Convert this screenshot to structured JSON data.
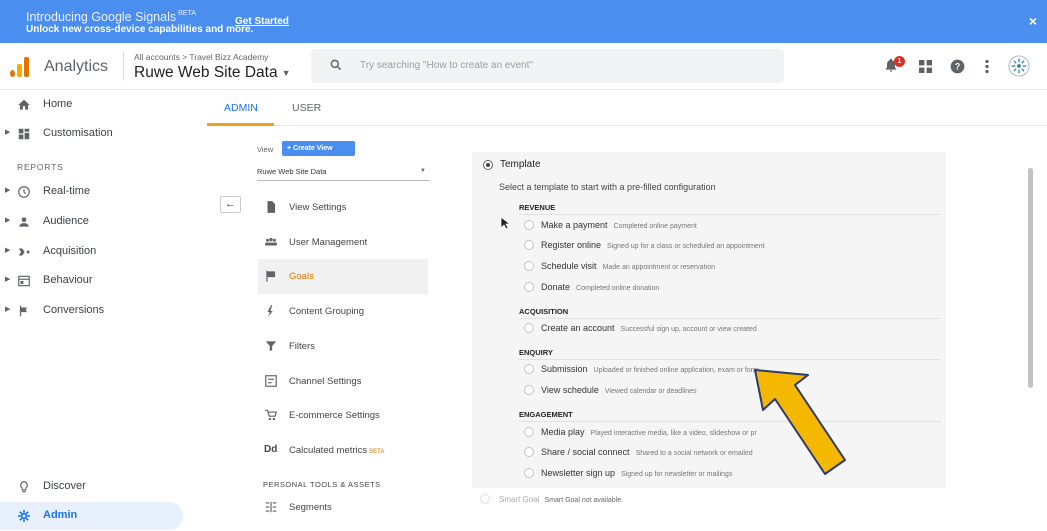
{
  "banner": {
    "title": "Introducing Google Signals",
    "badge": "BETA",
    "subtitle": "Unlock new cross-device capabilities and more.",
    "cta": "Get Started",
    "close": "×"
  },
  "header": {
    "app_name": "Analytics",
    "breadcrumb": "All accounts > Travel Bizz Academy",
    "property": "Ruwe Web Site Data",
    "search_placeholder": "Try searching \"How to create an event\"",
    "notification_count": "1"
  },
  "nav": {
    "home": "Home",
    "customisation": "Customisation",
    "reports_section": "REPORTS",
    "realtime": "Real-time",
    "audience": "Audience",
    "acquisition": "Acquisition",
    "behaviour": "Behaviour",
    "conversions": "Conversions",
    "discover": "Discover",
    "admin": "Admin"
  },
  "tabs": {
    "admin": "ADMIN",
    "user": "USER"
  },
  "view": {
    "label": "View",
    "create_button": "+ Create View",
    "selected": "Ruwe Web Site Data",
    "back": "←",
    "menu": {
      "view_settings": "View Settings",
      "user_management": "User Management",
      "goals": "Goals",
      "content_grouping": "Content Grouping",
      "filters": "Filters",
      "channel_settings": "Channel Settings",
      "ecommerce_settings": "E-commerce Settings",
      "calculated_metrics": "Calculated metrics",
      "beta": "BETA",
      "segments": "Segments"
    },
    "personal_section": "PERSONAL TOOLS & ASSETS"
  },
  "goal": {
    "template_label": "Template",
    "template_subtitle": "Select a template to start with a pre-filled configuration",
    "categories": {
      "revenue": "REVENUE",
      "acquisition": "ACQUISITION",
      "enquiry": "ENQUIRY",
      "engagement": "ENGAGEMENT"
    },
    "options": {
      "make_payment": {
        "name": "Make a payment",
        "desc": "Completed online payment"
      },
      "register_online": {
        "name": "Register online",
        "desc": "Signed up for a class or scheduled an appointment"
      },
      "schedule_visit": {
        "name": "Schedule visit",
        "desc": "Made an appointment or reservation"
      },
      "donate": {
        "name": "Donate",
        "desc": "Completed online donation"
      },
      "create_account": {
        "name": "Create an account",
        "desc": "Successful sign up, account or view created"
      },
      "submission": {
        "name": "Submission",
        "desc": "Uploaded or finished online application, exam or form"
      },
      "view_schedule": {
        "name": "View schedule",
        "desc": "Viewed calendar or deadlines"
      },
      "media_play": {
        "name": "Media play",
        "desc": "Played interactive media, like a video, slideshow or pr"
      },
      "share_social": {
        "name": "Share / social connect",
        "desc": "Shared to a social network or emailed"
      },
      "newsletter": {
        "name": "Newsletter sign up",
        "desc": "Signed up for newsletter or mailings"
      }
    },
    "smart_goal": {
      "name": "Smart Goal",
      "desc": "Smart Goal not available."
    }
  },
  "colors": {
    "banner": "#4a8ef0",
    "accent": "#1a73e8",
    "active_goal": "#e37400",
    "arrow_fill": "#f5b800",
    "arrow_stroke": "#2e3a6b"
  },
  "icons": {
    "notification": "bell-icon",
    "apps": "apps-grid-icon",
    "help": "help-icon",
    "more": "more-vert-icon",
    "account": "account-avatar-icon"
  }
}
